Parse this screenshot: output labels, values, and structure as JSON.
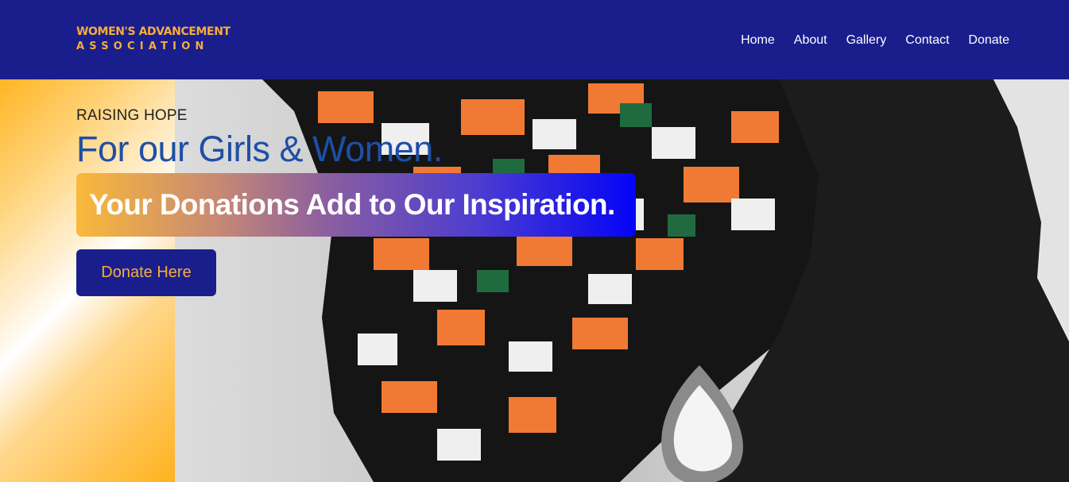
{
  "header": {
    "logo_line1": "WOMEN'S ADVANCEMENT",
    "logo_line2": "ASSOCIATION",
    "nav": [
      {
        "label": "Home"
      },
      {
        "label": "About"
      },
      {
        "label": "Gallery"
      },
      {
        "label": "Contact"
      },
      {
        "label": "Donate"
      }
    ]
  },
  "hero": {
    "kicker": "RAISING HOPE",
    "title": "For our Girls & Women.",
    "banner": "Your Donations Add to Our Inspiration.",
    "cta_label": "Donate Here"
  },
  "colors": {
    "header_bg": "#1a1e8c",
    "logo_accent": "#f5ad3d",
    "title_blue": "#1f4fa6",
    "banner_start": "#f9b93a",
    "banner_end": "#0404f6"
  }
}
